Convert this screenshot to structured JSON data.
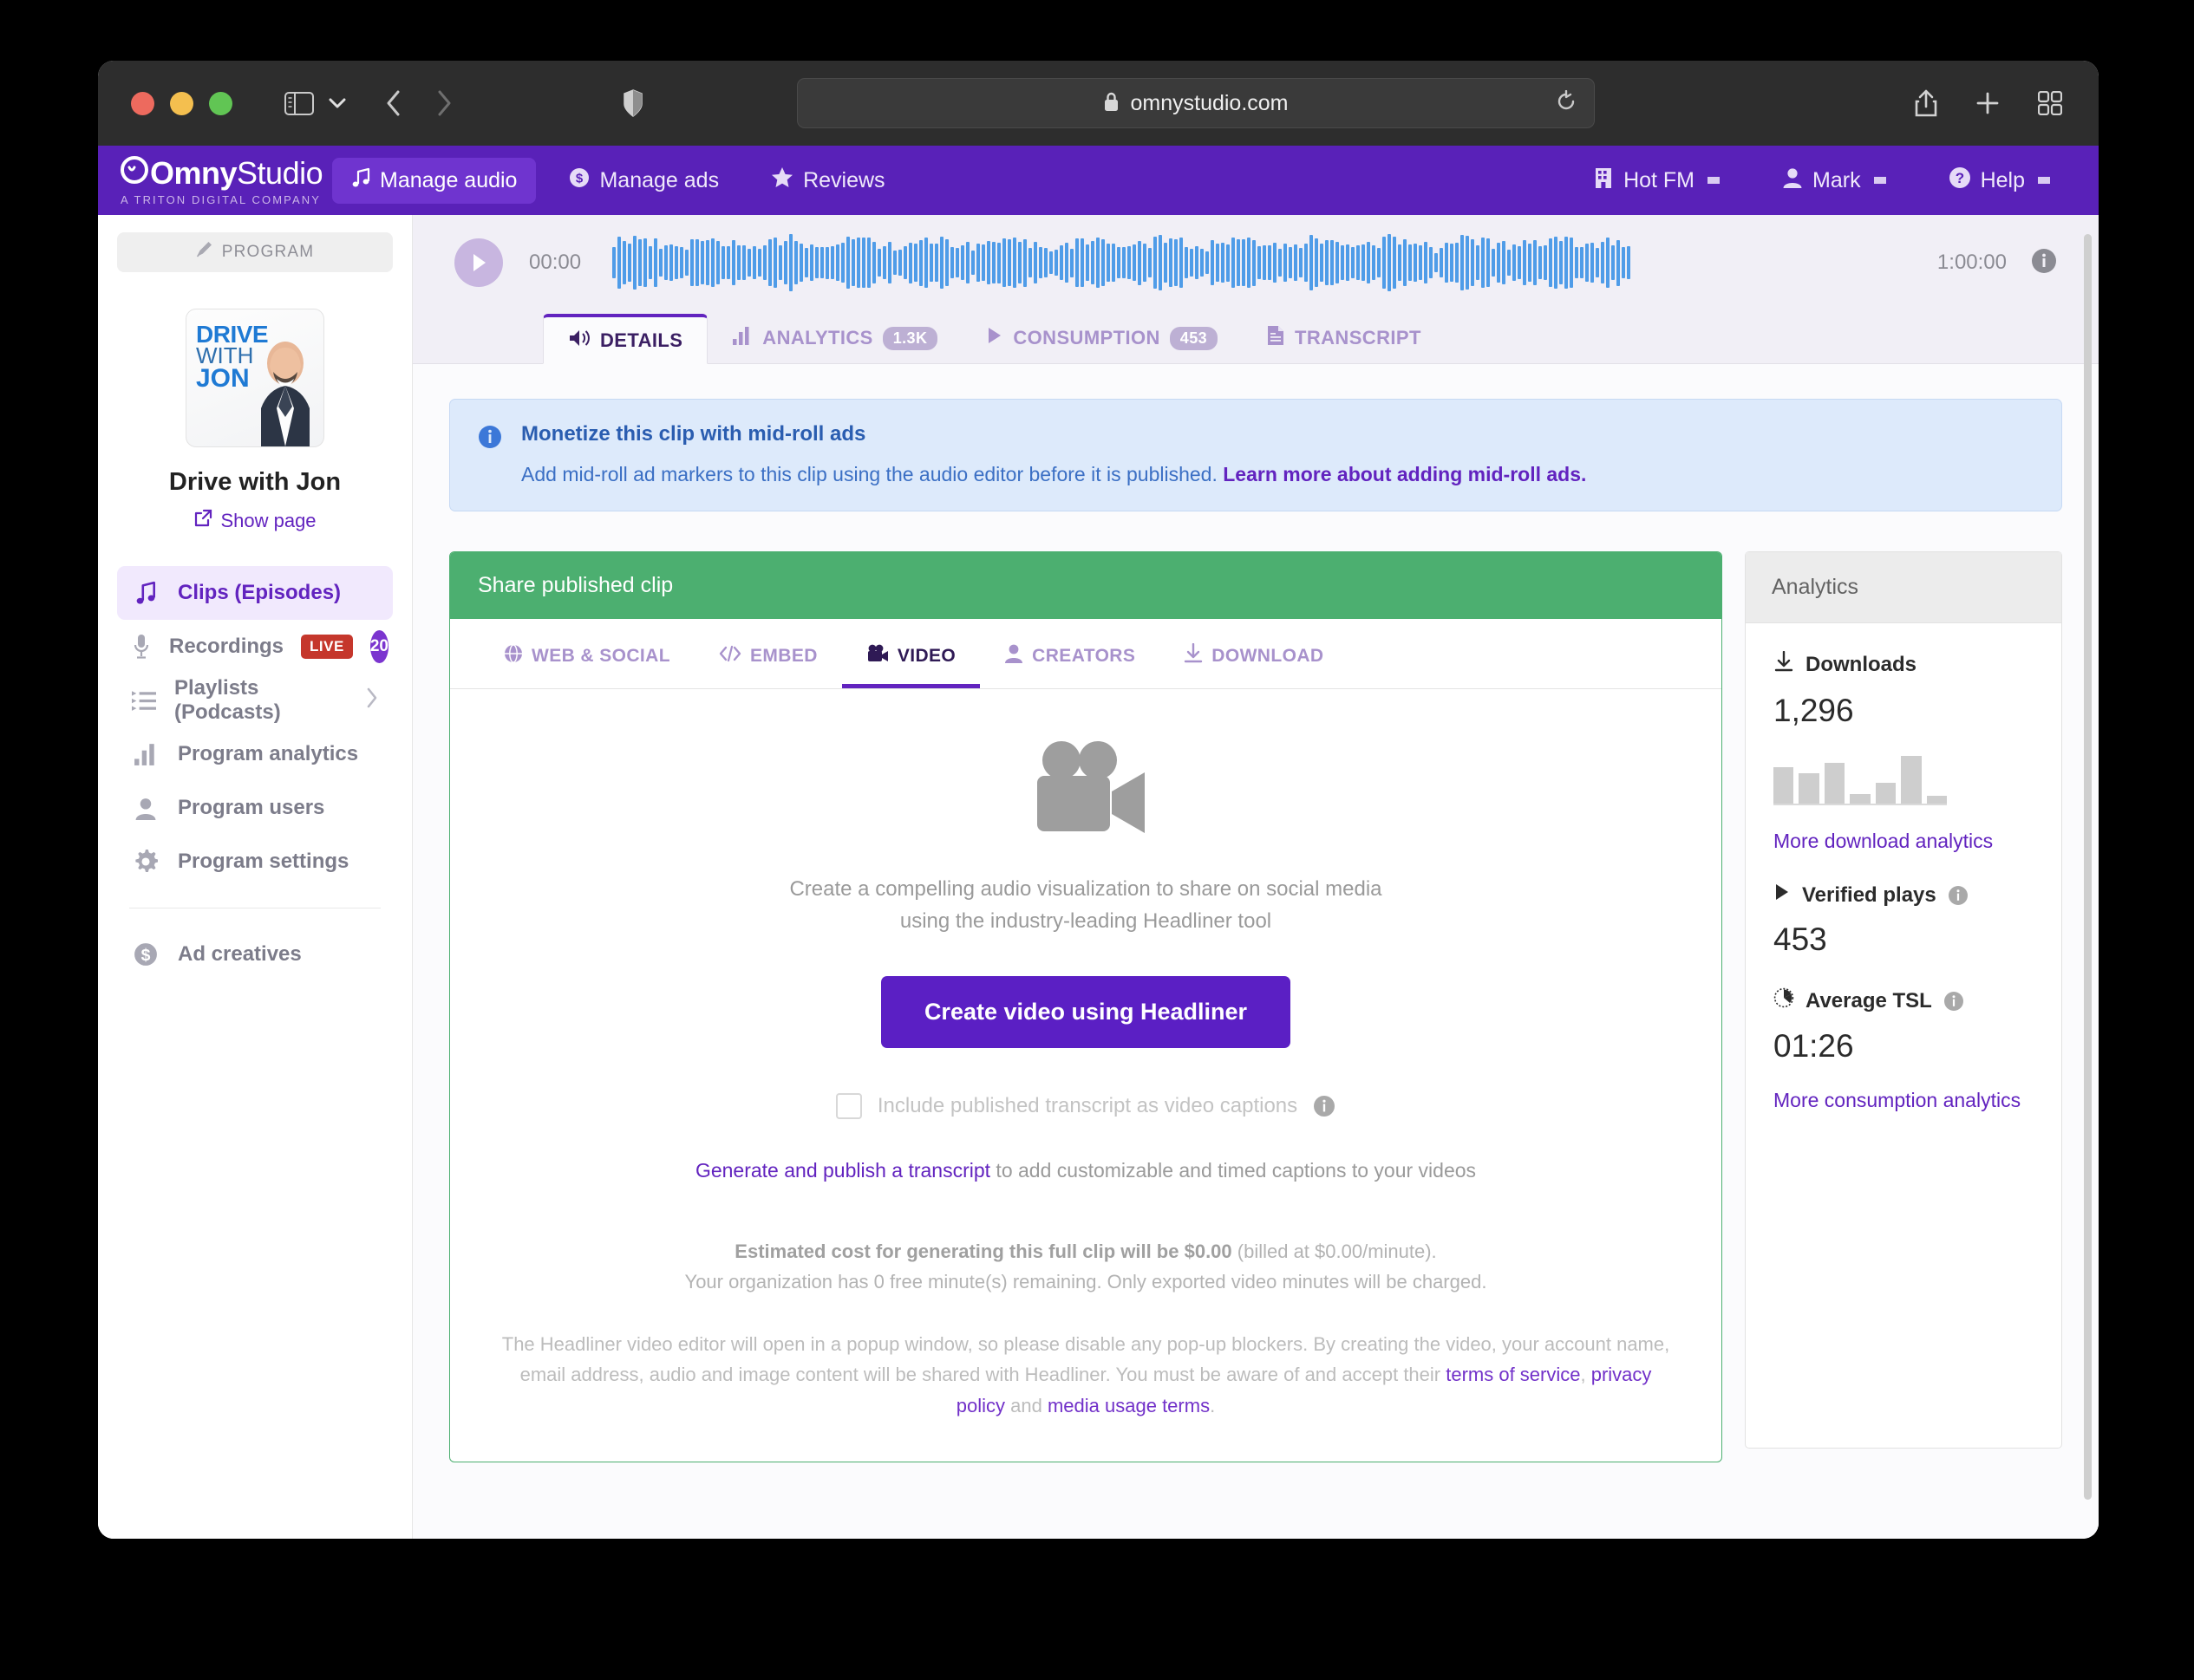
{
  "browser": {
    "url": "omnystudio.com",
    "lock_icon": "lock-icon",
    "shield_icon": "shield-icon",
    "reload_icon": "reload-icon",
    "share_icon": "share-icon",
    "newtab_icon": "plus-icon",
    "tabs_icon": "tab-overview-icon",
    "back_icon": "chevron-left-icon",
    "forward_icon": "chevron-right-icon",
    "sidebar_icon": "sidebar-toggle-icon",
    "sidebar_dropdown_icon": "chevron-down-icon"
  },
  "header": {
    "logo_bold": "Omny",
    "logo_light": "Studio",
    "logo_sub": "A TRITON DIGITAL COMPANY",
    "nav": [
      {
        "label": "Manage audio",
        "icon": "music-note-icon",
        "active": true
      },
      {
        "label": "Manage ads",
        "icon": "dollar-circle-icon",
        "active": false
      },
      {
        "label": "Reviews",
        "icon": "star-icon",
        "active": false
      }
    ],
    "right": [
      {
        "label": "Hot FM",
        "icon": "building-icon"
      },
      {
        "label": "Mark",
        "icon": "user-icon"
      },
      {
        "label": "Help",
        "icon": "question-circle-icon"
      }
    ]
  },
  "sidebar": {
    "program_pill": "PROGRAM",
    "program_pill_icon": "microphone-icon",
    "cover_art": {
      "line1": "DRIVE",
      "line2": "WITH",
      "line3": "JON"
    },
    "program_title": "Drive with Jon",
    "show_page_label": "Show page",
    "show_page_icon": "external-link-icon",
    "items": [
      {
        "label": "Clips (Episodes)",
        "icon": "music-note-icon",
        "active": true
      },
      {
        "label": "Recordings",
        "icon": "microphone-icon",
        "badge_live": "LIVE",
        "badge_count": "20"
      },
      {
        "label": "Playlists (Podcasts)",
        "icon": "playlist-icon",
        "chevron": true
      },
      {
        "label": "Program analytics",
        "icon": "bar-chart-icon"
      },
      {
        "label": "Program users",
        "icon": "user-icon"
      },
      {
        "label": "Program settings",
        "icon": "gear-icon"
      }
    ],
    "items_secondary": [
      {
        "label": "Ad creatives",
        "icon": "dollar-circle-icon"
      }
    ]
  },
  "player": {
    "play_icon": "play-icon",
    "current_time": "00:00",
    "total_time": "1:00:00",
    "info_icon": "info-icon"
  },
  "tabs": [
    {
      "label": "DETAILS",
      "icon": "speaker-icon",
      "badge": "",
      "active": true
    },
    {
      "label": "ANALYTICS",
      "icon": "bar-chart-icon",
      "badge": "1.3K",
      "active": false
    },
    {
      "label": "CONSUMPTION",
      "icon": "play-triangle-icon",
      "badge": "453",
      "active": false
    },
    {
      "label": "TRANSCRIPT",
      "icon": "document-icon",
      "badge": "",
      "active": false
    }
  ],
  "info_banner": {
    "icon": "info-icon",
    "title": "Monetize this clip with mid-roll ads",
    "body_prefix": "Add mid-roll ad markers to this clip using the audio editor before it is published. ",
    "link": "Learn more about adding mid-roll ads."
  },
  "share_card": {
    "header": "Share published clip",
    "subtabs": [
      {
        "label": "WEB & SOCIAL",
        "icon": "globe-icon",
        "active": false
      },
      {
        "label": "EMBED",
        "icon": "code-icon",
        "active": false
      },
      {
        "label": "VIDEO",
        "icon": "video-camera-icon",
        "active": true
      },
      {
        "label": "CREATORS",
        "icon": "user-icon",
        "active": false
      },
      {
        "label": "DOWNLOAD",
        "icon": "download-icon",
        "active": false
      }
    ],
    "video": {
      "camera_icon": "video-camera-icon",
      "desc_line1": "Create a compelling audio visualization to share on social media",
      "desc_line2": "using the industry-leading Headliner tool",
      "cta_label": "Create video using Headliner",
      "checkbox_label": "Include published transcript as video captions",
      "checkbox_checked": false,
      "checkbox_info_icon": "info-icon",
      "transcript_link": "Generate and publish a transcript",
      "transcript_rest": " to add customizable and timed captions to your videos",
      "cost_strong": "Estimated cost for generating this full clip will be $0.00",
      "cost_rest": " (billed at $0.00/minute).",
      "cost_line2": "Your organization has 0 free minute(s) remaining. Only exported video minutes will be charged.",
      "legal_part1": "The Headliner video editor will open in a popup window, so please disable any pop-up blockers. By creating the video, your account name, email address, audio and image content will be shared with Headliner. You must be aware of and accept their ",
      "legal_link1": "terms of service",
      "legal_sep1": ", ",
      "legal_link2": "privacy policy",
      "legal_sep2": " and ",
      "legal_link3": "media usage terms",
      "legal_end": "."
    }
  },
  "analytics": {
    "header": "Analytics",
    "downloads": {
      "icon": "download-icon",
      "label": "Downloads",
      "value": "1,296",
      "link": "More download analytics"
    },
    "verified_plays": {
      "icon": "play-triangle-icon",
      "label": "Verified plays",
      "value": "453",
      "info_icon": "info-icon"
    },
    "average_tsl": {
      "icon": "clock-icon",
      "label": "Average TSL",
      "value": "01:26",
      "info_icon": "info-icon",
      "link": "More consumption analytics"
    }
  },
  "chart_data": {
    "type": "bar",
    "title": "Downloads",
    "categories": [
      "1",
      "2",
      "3",
      "4",
      "5",
      "6",
      "7"
    ],
    "values": [
      70,
      58,
      78,
      18,
      40,
      92,
      15
    ],
    "xlabel": "",
    "ylabel": "",
    "ylim": [
      0,
      100
    ],
    "grid": false,
    "legend": "none",
    "color": "#cecece"
  },
  "colors": {
    "brand_purple": "#5921b8",
    "accent_purple": "#6223bf",
    "cta_purple": "#5b1fc4",
    "green": "#4caf70",
    "info_blue": "#ddeafb",
    "live_red": "#c5372c",
    "waveform_blue": "#4f9ce8"
  }
}
